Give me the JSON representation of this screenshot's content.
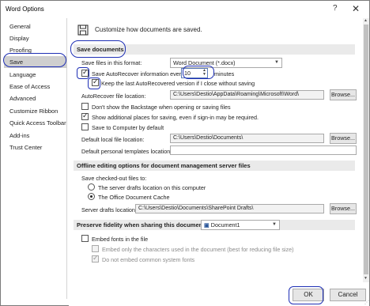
{
  "window": {
    "title": "Word Options",
    "help": "?",
    "close": "✕"
  },
  "sidebar": {
    "items": [
      {
        "label": "General"
      },
      {
        "label": "Display"
      },
      {
        "label": "Proofing"
      },
      {
        "label": "Save"
      },
      {
        "label": "Language"
      },
      {
        "label": "Ease of Access"
      },
      {
        "label": "Advanced"
      },
      {
        "label": "Customize Ribbon"
      },
      {
        "label": "Quick Access Toolbar"
      },
      {
        "label": "Add-ins"
      },
      {
        "label": "Trust Center"
      }
    ],
    "selected": "Save"
  },
  "header": {
    "text": "Customize how documents are saved."
  },
  "save_documents": {
    "title": "Save documents",
    "format_label": "Save files in this format:",
    "format_value": "Word Document (*.docx)",
    "autorecover_label": "Save AutoRecover information every",
    "autorecover_checked": true,
    "autorecover_minutes": "10",
    "minutes_label": "minutes",
    "keep_last_label": "Keep the last AutoRecovered version if I close without saving",
    "keep_last_checked": true,
    "autorecover_location_label": "AutoRecover file location:",
    "autorecover_location_value": "C:\\Users\\Destio\\AppData\\Roaming\\Microsoft\\Word\\",
    "browse": "Browse...",
    "backstage_label": "Don't show the Backstage when opening or saving files",
    "backstage_checked": false,
    "additional_places_label": "Show additional places for saving, even if sign-in may be required.",
    "additional_places_checked": true,
    "save_to_computer_label": "Save to Computer by default",
    "save_to_computer_checked": false,
    "default_local_label": "Default local file location:",
    "default_local_value": "C:\\Users\\Destio\\Documents\\",
    "default_templates_label": "Default personal templates location:",
    "default_templates_value": ""
  },
  "offline": {
    "title": "Offline editing options for document management server files",
    "checkedout_label": "Save checked-out files to:",
    "option_server": "The server drafts location on this computer",
    "option_cache": "The Office Document Cache",
    "selected": "The Office Document Cache",
    "server_drafts_label": "Server drafts location:",
    "server_drafts_value": "C:\\Users\\Destio\\Documents\\SharePoint Drafts\\",
    "browse": "Browse..."
  },
  "fidelity": {
    "title": "Preserve fidelity when sharing this document:",
    "document_value": "Document1",
    "embed_fonts_label": "Embed fonts in the file",
    "embed_fonts_checked": false,
    "embed_only_label": "Embed only the characters used in the document (best for reducing file size)",
    "embed_only_checked": false,
    "no_common_label": "Do not embed common system fonts",
    "no_common_checked": true
  },
  "footer": {
    "ok": "OK",
    "cancel": "Cancel"
  },
  "colors": {
    "annotation": "#1e2fb5",
    "selected_bg": "#cfcfcf",
    "band_bg": "#eaeaea"
  }
}
